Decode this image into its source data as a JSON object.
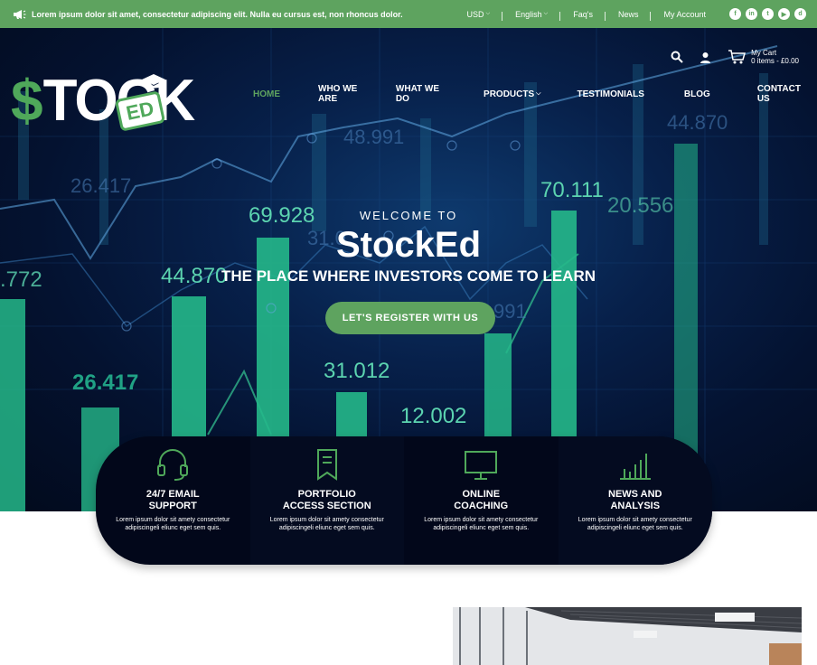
{
  "topbar": {
    "promo_text": "Lorem ipsum dolor sit amet, consectetur adipiscing elit. Nulla eu cursus est, non rhoncus dolor.",
    "currency": "USD",
    "language": "English",
    "faqs": "Faq's",
    "news": "News",
    "account": "My Account",
    "social_icons": [
      "facebook-icon",
      "linkedin-icon",
      "twitter-icon",
      "youtube-icon",
      "discord-icon"
    ]
  },
  "header": {
    "logo_dollar": "$",
    "logo_text": "TOCK",
    "logo_badge": "ED",
    "cart_title": "My Cart",
    "cart_summary": "0 items - £0.00"
  },
  "nav": {
    "items": [
      "HOME",
      "WHO WE ARE",
      "WHAT WE DO",
      "PRODUCTS",
      "TESTIMONIALS",
      "BLOG",
      "CONTACT US"
    ]
  },
  "hero": {
    "welcome": "WELCOME TO",
    "brand": "StockEd",
    "tagline": "THE PLACE WHERE INVESTORS COME TO LEARN",
    "cta": "LET'S REGISTER WITH US"
  },
  "features": [
    {
      "title1": "24/7 EMAIL",
      "title2": "SUPPORT",
      "desc": "Lorem ipsum dolor sit amety consectetur adipiscingeli eliunc eget sem quis.",
      "icon": "headset-icon"
    },
    {
      "title1": "PORTFOLIO",
      "title2": "ACCESS SECTION",
      "desc": "Lorem ipsum dolor sit amety consectetur adipiscingeli eliunc eget sem quis.",
      "icon": "bookmark-icon"
    },
    {
      "title1": "ONLINE",
      "title2": "COACHING",
      "desc": "Lorem ipsum dolor sit amety consectetur adipiscingeli eliunc eget sem quis.",
      "icon": "monitor-icon"
    },
    {
      "title1": "NEWS AND",
      "title2": "ANALYSIS",
      "desc": "Lorem ipsum dolor sit amety consectetur adipiscingeli eliunc eget sem quis.",
      "icon": "bar-chart-icon"
    }
  ],
  "colors": {
    "accent": "#5ea35f",
    "dark": "#02071a"
  }
}
